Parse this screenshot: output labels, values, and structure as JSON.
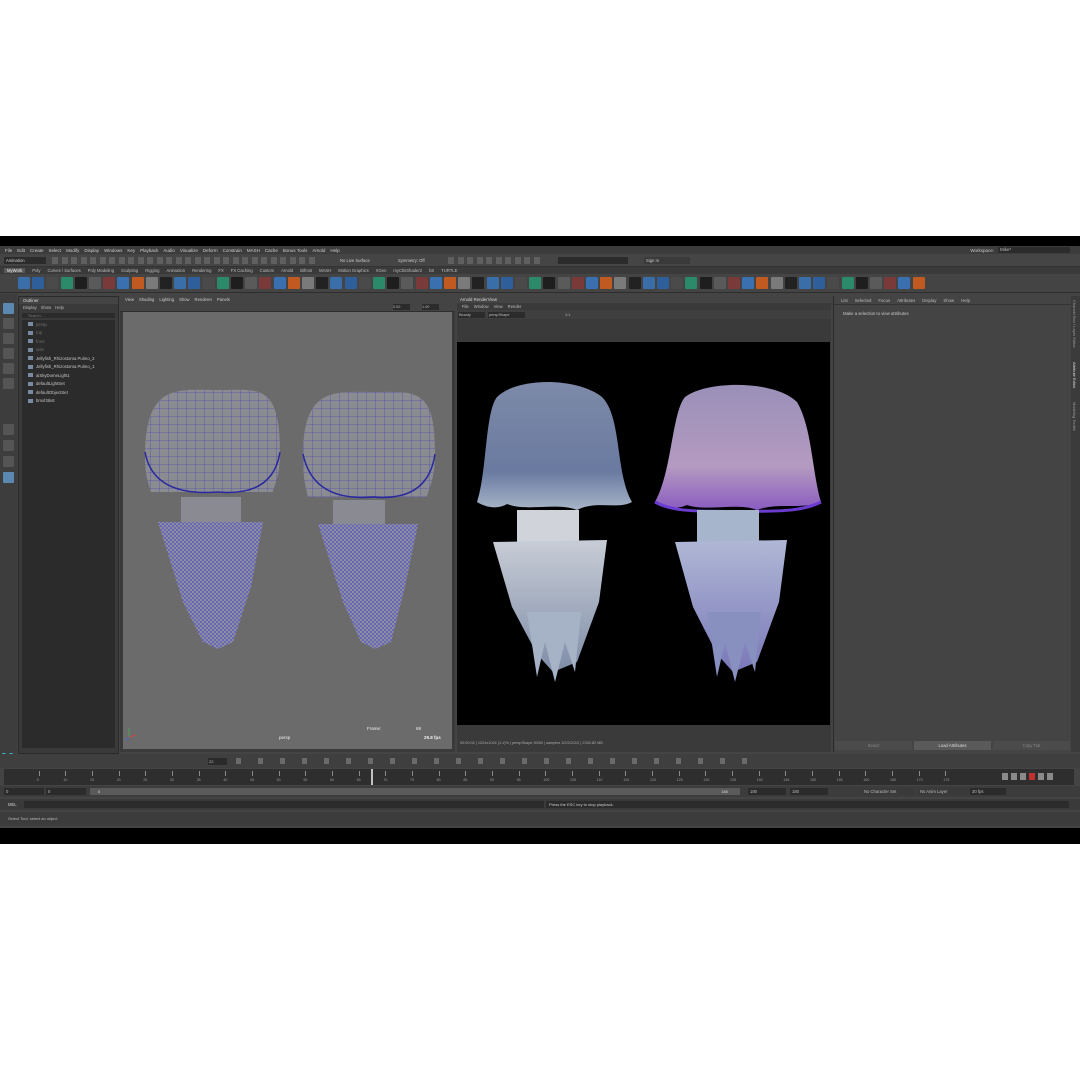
{
  "menubar": [
    "File",
    "Edit",
    "Create",
    "Select",
    "Modify",
    "Display",
    "Windows",
    "Key",
    "Playback",
    "Audio",
    "Visualize",
    "Deform",
    "Constrain",
    "MASH",
    "Cache",
    "Bonus Tools",
    "Arnold",
    "Help"
  ],
  "workspace": {
    "label": "Workspace:",
    "value": "Mike*"
  },
  "status": {
    "mode": "Animation",
    "live_surface": "No Live Surface",
    "symmetry": "Symmetry: Off",
    "sign_in": "Sign In"
  },
  "shelf_tabs": [
    "MyWork",
    "Poly",
    "Curves / Surfaces",
    "Poly Modeling",
    "Sculpting",
    "Rigging",
    "Animation",
    "Rendering",
    "FX",
    "FX Caching",
    "Custom",
    "Arnold",
    "Bifrost",
    "MASH",
    "Motion Graphics",
    "XGen",
    "myCtlsShader2",
    "bS",
    "TURTLE"
  ],
  "outliner": {
    "title": "Outliner",
    "menu": [
      "Display",
      "Show",
      "Help"
    ],
    "search_placeholder": "Search...",
    "items": [
      {
        "label": "persp",
        "dim": true
      },
      {
        "label": "top",
        "dim": true
      },
      {
        "label": "front",
        "dim": true
      },
      {
        "label": "side",
        "dim": true
      },
      {
        "label": "Jellyfish_Rhizostoma Pulmo_2",
        "dim": false
      },
      {
        "label": "Jellyfish_Rhizostoma Pulmo_1",
        "dim": false
      },
      {
        "label": "aiSkyDomeLight1",
        "dim": false
      },
      {
        "label": "defaultLightSet",
        "dim": false
      },
      {
        "label": "defaultObjectSet",
        "dim": false
      },
      {
        "label": "bmxl:Bkst",
        "dim": false
      }
    ]
  },
  "viewport": {
    "menu": [
      "View",
      "Shading",
      "Lighting",
      "Show",
      "Renderer",
      "Panels"
    ],
    "camera": "persp",
    "frame_label": "Frame:",
    "frame_value": "69",
    "fps": "29.8 fps",
    "field_a": "0.00",
    "field_b": "1.00"
  },
  "render_view": {
    "title": "Arnold RenderView",
    "menu": [
      "File",
      "Window",
      "View",
      "Render"
    ],
    "dropdown_a": "Beauty",
    "dropdown_b": "perspShape",
    "zoom": "1:1",
    "status": "00:00:02 | 1024x1024 (1:1)% | perspShape 30/50 | samples 3/2/2/2/2/2 | 2330.82 MB"
  },
  "attribute_editor": {
    "menu": [
      "List",
      "Selected",
      "Focus",
      "Attributes",
      "Display",
      "Show",
      "Help"
    ],
    "message": "Make a selection to view attributes",
    "buttons": [
      "Select",
      "Load Attributes",
      "Copy Tab"
    ],
    "side_tabs": [
      "Channel Box / Layer Editor",
      "Attribute Editor",
      "Modeling Toolkit"
    ]
  },
  "time_slider": {
    "ticks": [
      "5",
      "10",
      "15",
      "20",
      "25",
      "30",
      "35",
      "40",
      "45",
      "50",
      "55",
      "60",
      "65",
      "70",
      "75",
      "80",
      "85",
      "90",
      "95",
      "100",
      "105",
      "110",
      "115",
      "120",
      "125",
      "130",
      "135",
      "140",
      "145",
      "150",
      "155",
      "160",
      "165",
      "170",
      "175"
    ],
    "current_frame": "69",
    "current_display": "22"
  },
  "range": {
    "start": "0",
    "start_inner": "0",
    "range_left": "0",
    "range_end_inner": "180",
    "end_inner": "180",
    "end": "180",
    "character_set": "No Character Set",
    "anim_layer": "No Anim Layer",
    "fps": "30 fps"
  },
  "command_line": {
    "lang": "MEL",
    "feedback": "Press the ESC key to stop playback."
  },
  "help_line": "Select Tool: select an object",
  "colors": {
    "accent": "#37b3c2",
    "viewport_bg": "#6b6b6b",
    "wire": "#3a3ad0",
    "render_bg": "#000000"
  }
}
